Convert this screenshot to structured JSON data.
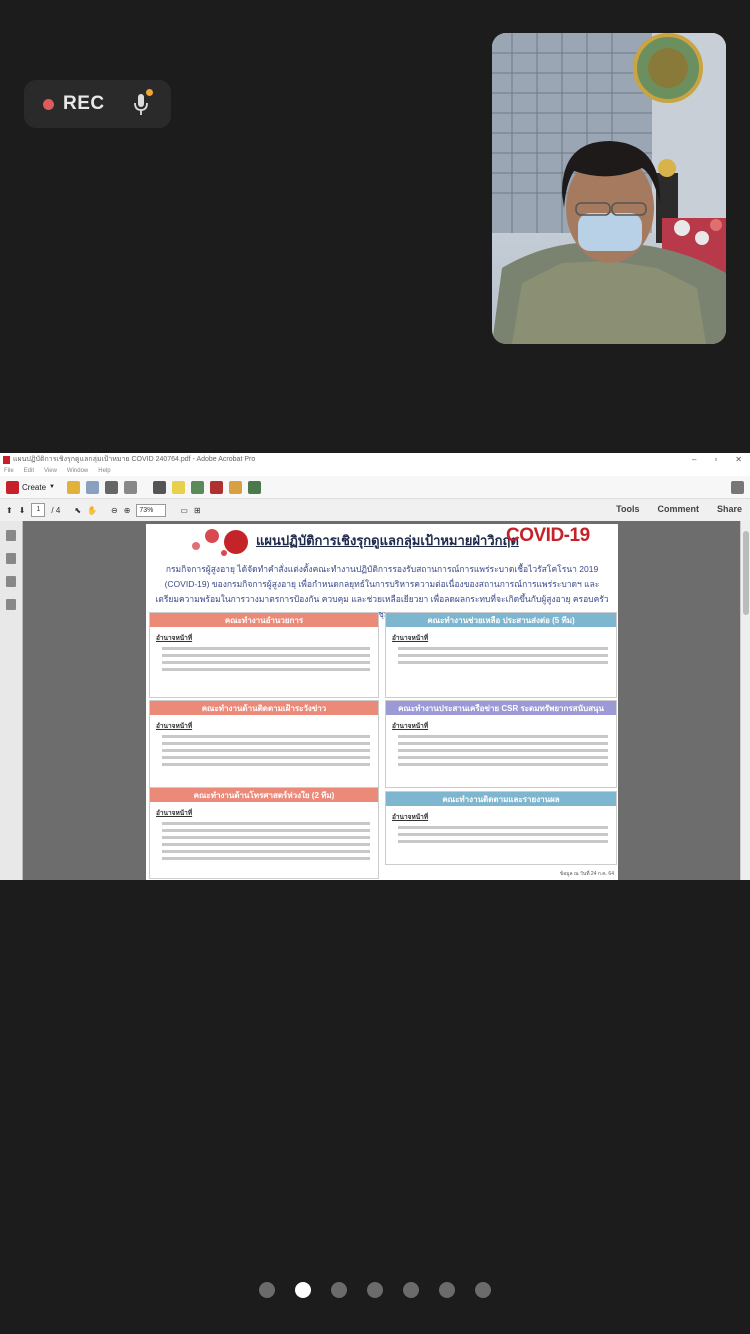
{
  "recording": {
    "label": "REC"
  },
  "pdf_window": {
    "title": "แผนปฏิบัติการเชิงรุกดูแลกลุ่มเป้าหมาย COVID 240764.pdf - Adobe Acrobat Pro",
    "menu": [
      "File",
      "Edit",
      "View",
      "Window",
      "Help"
    ],
    "toolbar": {
      "create_label": "Create"
    },
    "page_nav": {
      "current_page": "1",
      "total_pages": "/ 4",
      "zoom": "73%"
    },
    "right_links": [
      "Tools",
      "Comment",
      "Share"
    ]
  },
  "document": {
    "title": "แผนปฏิบัติการเชิงรุกดูแลกลุ่มเป้าหมายฝ่าวิกฤต",
    "covid_label": "COVID-19",
    "intro_line_1": "กรมกิจการผู้สูงอายุ ได้จัดทำคำสั่งแต่งตั้งคณะทำงานปฏิบัติการรองรับสถานการณ์การแพร่ระบาดเชื้อไวรัสโคโรนา 2019",
    "intro_line_2": "(COVID-19) ของกรมกิจการผู้สูงอายุ เพื่อกำหนดกลยุทธ์ในการบริหารความต่อเนื่องของสถานการณ์การแพร่ระบาดฯ และ",
    "intro_line_3": "เตรียมความพร้อมในการวางมาตรการป้องกัน ควบคุม และช่วยเหลือเยียวยา เพื่อลดผลกระทบที่จะเกิดขึ้นกับผู้สูงอายุ ครอบครัว และชุมชน",
    "duty_label": "อำนาจหน้าที่",
    "boxes": [
      {
        "header": "คณะทำงานอำนวยการ",
        "color": "#ec8a7a"
      },
      {
        "header": "คณะทำงานช่วยเหลือ ประสานส่งต่อ (5 ทีม)",
        "color": "#7fb6cf"
      },
      {
        "header": "คณะทำงานด้านติดตามเฝ้าระวังข่าว",
        "color": "#ec8a7a"
      },
      {
        "header": "คณะทำงานประสานเครือข่าย CSR ระดมทรัพยากรสนับสนุน",
        "color": "#9c9ad6"
      },
      {
        "header": "คณะทำงานด้านโทรศาสตร์ห่วงใย (2 ทีม)",
        "color": "#ec8a7a"
      },
      {
        "header": "คณะทำงานติดตามและรายงานผล",
        "color": "#7fb6cf"
      }
    ],
    "footnote": "ข้อมูล ณ วันที่ 24 ก.ค. 64"
  },
  "pagination": {
    "total": 7,
    "active_index": 1
  },
  "colors": {
    "rec_dot": "#e0595b",
    "mic_activity": "#f0a630",
    "covid_red": "#c4232a"
  }
}
